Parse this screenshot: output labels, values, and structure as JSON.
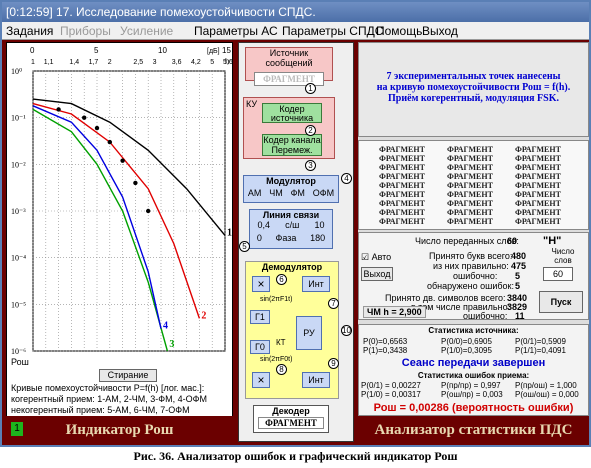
{
  "window": {
    "title": "[0:12:59] 17. Исследование помехоустойчивости СПДС."
  },
  "menu": [
    "Задания",
    "Приборы",
    "Усиление",
    "Параметры АС",
    "Параметры СПДС",
    "Помощь",
    "Выход"
  ],
  "plot": {
    "db_label": "[дБ]",
    "db_ticks": [
      "0",
      "5",
      "10",
      "15"
    ],
    "h_ticks": [
      "1",
      "1,1",
      "1,4",
      "1,7",
      "2",
      "2,5",
      "3",
      "3,6",
      "4,2",
      "5",
      "5,6"
    ],
    "h_label": "h",
    "y_ticks": [
      "10⁰",
      "10⁻¹",
      "10⁻²",
      "10⁻³",
      "10⁻⁴",
      "10⁻⁵",
      "10⁻⁶"
    ],
    "y_axis_name": "Рош",
    "clear_button": "Стирание",
    "curve_labels": [
      "1",
      "2",
      "3",
      "4"
    ],
    "desc1": "Кривые помехоустойчивости P=f(h) [лог. мас.]:",
    "desc2": "когерентный прием: 1-АМ, 2-ЧМ, 3-ФМ, 4-ОФМ",
    "desc3": "некогерентный прием: 5-АМ, 6-ЧМ, 7-ОФМ"
  },
  "indicator_left": {
    "label": "Индикатор Рош",
    "badge": "1"
  },
  "chain": {
    "source_title": "Источник сообщений",
    "fragment": "ФРАГМЕНТ",
    "ku": "КУ",
    "source_coder": "Кодер источника",
    "channel_coder": "Кодер канала",
    "interleave": "Перемеж.",
    "modulator_title": "Модулятор",
    "mod_options": [
      "АМ",
      "ЧМ",
      "ФМ",
      "ОФМ"
    ],
    "line_title": "Линия связи",
    "line_vals": {
      "a": "0,4",
      "cw": "с/ш",
      "b": "10"
    },
    "phase_vals": {
      "a": "0",
      "label": "Фаза",
      "b": "180"
    },
    "demod_title": "Демодулятор",
    "int_label": "Инт",
    "sin1": "sin(2πF1t)",
    "sin0": "sin(2πF0t)",
    "g1": "Г1",
    "g0": "Г0",
    "ru": "РУ",
    "kt": "КТ",
    "decoder_title": "Декодер",
    "decoder_fragment": "ФРАГМЕНТ",
    "nodes": [
      "1",
      "2",
      "3",
      "4",
      "5",
      "6",
      "7",
      "8",
      "9",
      "10"
    ]
  },
  "info": {
    "line1": "7 экспериментальных точек нанесены",
    "line2": "на кривую помехоустойчивости Рош = f(h).",
    "line3": "Приём когерентный, модуляция FSK."
  },
  "fragments": [
    "ФРАГМЕНТ",
    "ФРАГМЕНТ",
    "ФРАГМЕНТ"
  ],
  "stats": {
    "words_sent_label": "Число переданных слов:",
    "words_sent": "60",
    "h_label": "\"H\"",
    "words_count_label": "Число слов",
    "words_count_value": "60",
    "auto_label": "Авто",
    "exit_label": "Выход",
    "received_label": "Принято букв всего:",
    "received": "480",
    "correct_label": "из них правильно:",
    "correct": "475",
    "errors_label": "ошибочно:",
    "errors": "5",
    "detected_label": "обнаружено ошибок:",
    "detected": "5",
    "bits_label": "Принято дв. символов всего:",
    "bits": "3840",
    "bits_ok_label": "в том числе правильно:",
    "bits_ok": "3829",
    "bits_err_label": "ошибочно:",
    "bits_err": "11",
    "chm_label": "ЧМ  h = 2,900",
    "start_button": "Пуск"
  },
  "source_stats": {
    "title": "Статистика источника:",
    "p0": "P(0)=0,6563",
    "p1": "P(1)=0,3438",
    "p00": "P(0/0)=0,6905",
    "p01": "P(0/1)=0,5909",
    "p10": "P(1/0)=0,3095",
    "p11": "P(1/1)=0,4091",
    "session": "Сеанс передачи завершен",
    "err_title": "Статистика ошибок приема:",
    "e01": "P(0/1) = 0,00227",
    "e10": "P(1/0) = 0,00317",
    "enpr": "P(пр/пр) = 0,997",
    "eosh": "P(ош/пр) = 0,003",
    "enposh": "P(пр/ош) = 1,000",
    "eoshosh": "P(ош/ош) = 0,000",
    "result": "Рош = 0,00286 (вероятность ошибки)"
  },
  "indicator_right": {
    "label": "Анализатор статистики ПДС"
  },
  "caption": "Рис. 36. Анализатор ошибок и графический индикатор Рош",
  "chart_data": {
    "type": "line",
    "title": "",
    "xlabel": "h",
    "ylabel": "Рош",
    "yscale": "log",
    "x_db_range": [
      0,
      15
    ],
    "ylim": [
      1e-06,
      1
    ],
    "series": [
      {
        "name": "1",
        "x": [
          0,
          3,
          6,
          9,
          12,
          15
        ],
        "y": [
          0.25,
          0.2,
          0.08,
          0.02,
          0.003,
          0.0003
        ]
      },
      {
        "name": "2",
        "x": [
          0,
          3,
          6,
          9,
          11,
          13
        ],
        "y": [
          0.2,
          0.12,
          0.03,
          0.003,
          0.0002,
          5e-06
        ]
      },
      {
        "name": "3",
        "x": [
          0,
          3,
          5,
          7,
          9,
          10.5
        ],
        "y": [
          0.15,
          0.05,
          0.01,
          0.001,
          3e-05,
          1e-06
        ]
      },
      {
        "name": "4",
        "x": [
          0,
          3,
          5,
          7,
          9,
          10
        ],
        "y": [
          0.18,
          0.08,
          0.02,
          0.002,
          5e-05,
          3e-06
        ]
      }
    ],
    "points": {
      "x": [
        2,
        4,
        5,
        6,
        7,
        8,
        9
      ],
      "y": [
        0.15,
        0.1,
        0.06,
        0.03,
        0.012,
        0.004,
        0.001
      ]
    }
  }
}
